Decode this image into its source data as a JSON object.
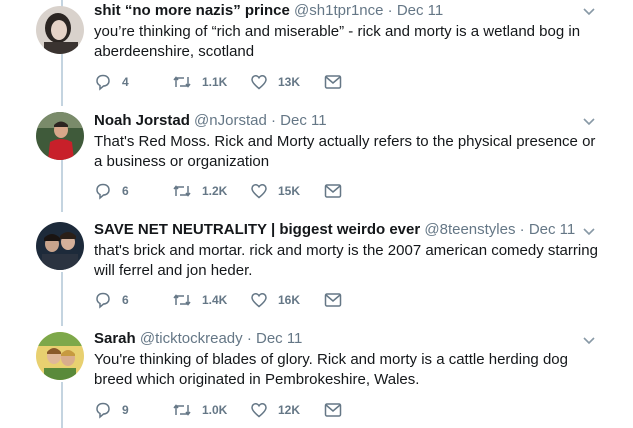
{
  "tweets": [
    {
      "name": "shit “no more nazis” prince",
      "handle": "@sh1tpr1nce",
      "sep": "·",
      "time": "Dec 11",
      "text": "you’re thinking of “rich and miserable” - rick and morty is a wetland bog in aberdeenshire, scotland",
      "replies": "4",
      "retweets": "1.1K",
      "likes": "13K"
    },
    {
      "name": "Noah Jorstad",
      "handle": "@nJorstad",
      "sep": "·",
      "time": "Dec 11",
      "text": "That's Red Moss. Rick and Morty actually refers to the physical presence or a business or organization",
      "replies": "6",
      "retweets": "1.2K",
      "likes": "15K"
    },
    {
      "name": "SAVE NET NEUTRALITY | biggest weirdo ever",
      "handle": "@8teenstyles",
      "sep": "·",
      "time": "Dec 11",
      "text": "that's brick and mortar. rick and morty is the 2007 american comedy starring will ferrel and jon heder.",
      "replies": "6",
      "retweets": "1.4K",
      "likes": "16K"
    },
    {
      "name": "Sarah",
      "handle": "@ticktockready",
      "sep": "·",
      "time": "Dec 11",
      "text": "You're thinking of blades of glory. Rick and morty is a cattle herding dog breed which originated in Pembrokeshire, Wales.",
      "replies": "9",
      "retweets": "1.0K",
      "likes": "12K"
    }
  ],
  "icons": {
    "reply": "reply-icon",
    "retweet": "retweet-icon",
    "like": "heart-icon",
    "dm": "envelope-icon",
    "caret": "chevron-down-icon"
  },
  "colors": {
    "icon_gray": "#657786",
    "thread_line": "#c4d4e0",
    "text": "#14171a"
  }
}
